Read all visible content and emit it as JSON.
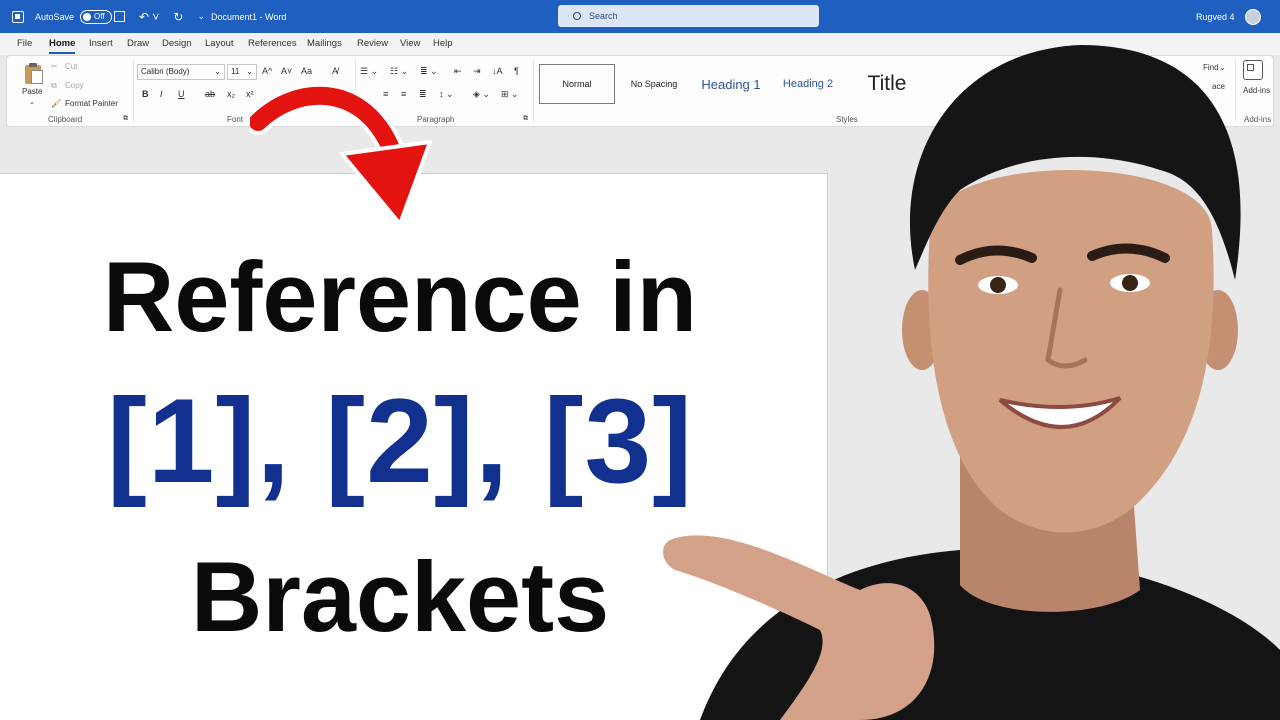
{
  "titlebar": {
    "autosave_label": "AutoSave",
    "autosave_state": "Off",
    "document_title": "Document1  -  Word",
    "search_placeholder": "Search",
    "user_name": "Rugved 4"
  },
  "tabs": [
    "File",
    "Home",
    "Insert",
    "Draw",
    "Design",
    "Layout",
    "References",
    "Mailings",
    "Review",
    "View",
    "Help"
  ],
  "ribbon": {
    "clipboard": {
      "paste": "Paste",
      "cut": "Cut",
      "copy": "Copy",
      "format_painter": "Format Painter",
      "label": "Clipboard"
    },
    "font": {
      "font_name": "Calibri (Body)",
      "font_size": "11",
      "label": "Font",
      "bold": "B",
      "italic": "I",
      "underline": "U",
      "strikethrough": "ab",
      "subscript": "x₂",
      "superscript": "x²",
      "grow": "A^",
      "shrink": "A˅",
      "change_case": "Aa"
    },
    "paragraph": {
      "label": "Paragraph"
    },
    "styles": {
      "label": "Styles",
      "items": [
        "Normal",
        "No Spacing",
        "Heading 1",
        "Heading 2",
        "Title"
      ]
    },
    "editing": {
      "find": "Find",
      "replace": "ace"
    },
    "addins": {
      "button": "Add-ins",
      "label": "Add-ins"
    }
  },
  "document": {
    "line1": "Reference in",
    "line2": "[1], [2], [3]",
    "line3": "Brackets"
  },
  "colors": {
    "titlebar": "#1e5fc0",
    "headline_black": "#0a0a0a",
    "headline_blue": "#12318f",
    "arrow_red": "#e3130f"
  },
  "icons": [
    "word-logo-icon",
    "undo-icon",
    "redo-icon",
    "save-icon",
    "search-icon",
    "paste-icon",
    "scissors-icon",
    "copy-icon",
    "brush-icon",
    "pilcrow-icon",
    "add-ins-icon",
    "red-arrow-icon"
  ]
}
